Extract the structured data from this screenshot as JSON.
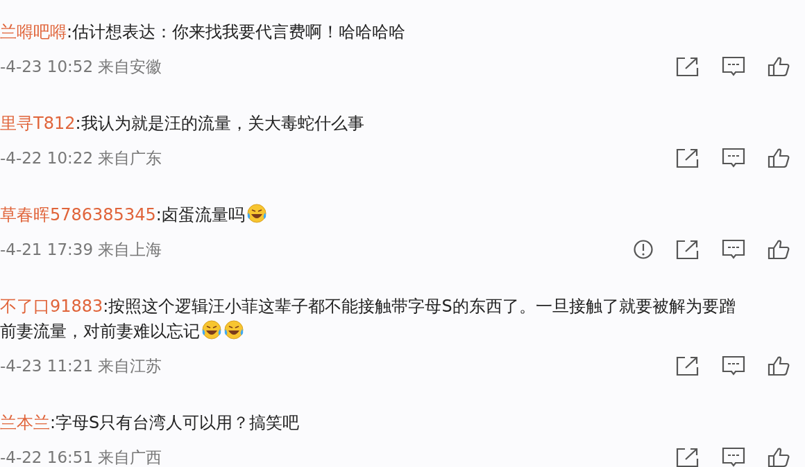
{
  "comments": [
    {
      "user": "兰嘚吧嘚",
      "content": [
        {
          "kind": "text",
          "text": ":估计想表达：你来找我要代言费啊！哈哈哈哈"
        }
      ],
      "meta": "-4-23 10:52 来自安徽",
      "actions": [
        {
          "kind": "share"
        },
        {
          "kind": "comment"
        },
        {
          "kind": "like"
        }
      ]
    },
    {
      "user": "里寻T812",
      "content": [
        {
          "kind": "text",
          "text": ":我认为就是汪的流量，关大毒蛇什么事"
        }
      ],
      "meta": "-4-22 10:22 来自广东",
      "actions": [
        {
          "kind": "share"
        },
        {
          "kind": "comment"
        },
        {
          "kind": "like"
        }
      ]
    },
    {
      "user": "草春晖5786385345",
      "content": [
        {
          "kind": "text",
          "text": ":卤蛋流量吗"
        },
        {
          "kind": "emoji"
        }
      ],
      "meta": "-4-21 17:39 来自上海",
      "actions": [
        {
          "kind": "report"
        },
        {
          "kind": "share"
        },
        {
          "kind": "comment"
        },
        {
          "kind": "like"
        }
      ]
    },
    {
      "user": "不了口91883",
      "content": [
        {
          "kind": "text",
          "text": ":按照这个逻辑汪小菲这辈子都不能接触带字母S的东西了。一旦接触了就要被解为要蹭前妻流量，对前妻难以忘记"
        },
        {
          "kind": "emoji"
        },
        {
          "kind": "emoji"
        }
      ],
      "meta": "-4-23 11:21 来自江苏",
      "actions": [
        {
          "kind": "share"
        },
        {
          "kind": "comment"
        },
        {
          "kind": "like"
        }
      ]
    },
    {
      "user": "兰本兰",
      "content": [
        {
          "kind": "text",
          "text": ":字母S只有台湾人可以用？搞笑吧"
        }
      ],
      "meta": "-4-22 16:51 来自广西",
      "actions": [
        {
          "kind": "share"
        },
        {
          "kind": "comment"
        },
        {
          "kind": "like"
        }
      ]
    }
  ]
}
